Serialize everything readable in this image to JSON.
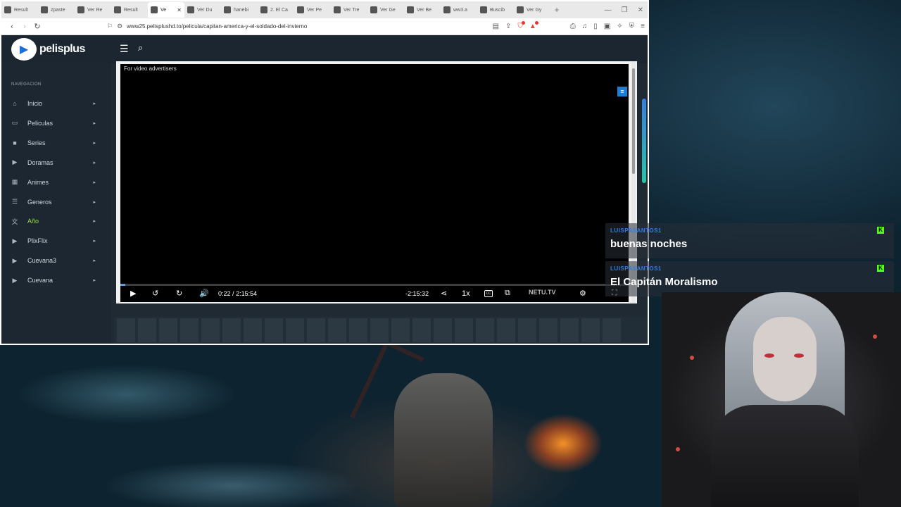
{
  "browser": {
    "tabs": [
      {
        "label": "Result",
        "icon": "google-icon",
        "active": false
      },
      {
        "label": "zpaste",
        "icon": "sync-icon",
        "active": false
      },
      {
        "label": "Ver Re",
        "icon": "c-icon",
        "active": false
      },
      {
        "label": "Result",
        "icon": "c-icon",
        "active": false
      },
      {
        "label": "Ve",
        "icon": "p-icon",
        "active": true
      },
      {
        "label": "Ver Du",
        "icon": "c-icon",
        "active": false
      },
      {
        "label": "hanebi",
        "icon": "m-icon",
        "active": false
      },
      {
        "label": "2. El Ca",
        "icon": "doc-icon",
        "active": false
      },
      {
        "label": "Ver Pe",
        "icon": "circle-icon",
        "active": false
      },
      {
        "label": "Ver Tre",
        "icon": "arrow-icon",
        "active": false
      },
      {
        "label": "Ver Ge",
        "icon": "arrow-icon",
        "active": false
      },
      {
        "label": "Ver Be",
        "icon": "circle-icon",
        "active": false
      },
      {
        "label": "ww3.a",
        "icon": "grid-icon",
        "active": false
      },
      {
        "label": "Buscib",
        "icon": "c-icon",
        "active": false
      },
      {
        "label": "Ver Gy",
        "icon": "p-icon",
        "active": false
      }
    ],
    "new_tab": "+",
    "url": "www25.pelisplushd.to/pelicula/capitan-america-y-el-soldado-del-invierno"
  },
  "site": {
    "logo_text": "pelisplus",
    "nav_heading": "NAVEGACION",
    "nav": [
      {
        "label": "Inicio",
        "icon": "home-icon",
        "glyph": "⌂",
        "active": false
      },
      {
        "label": "Peliculas",
        "icon": "monitor-icon",
        "glyph": "▭",
        "active": false
      },
      {
        "label": "Series",
        "icon": "camera-icon",
        "glyph": "■",
        "active": false
      },
      {
        "label": "Doramas",
        "icon": "play-icon",
        "glyph": "▶",
        "active": false
      },
      {
        "label": "Animes",
        "icon": "tv-icon",
        "glyph": "▦",
        "active": false
      },
      {
        "label": "Generos",
        "icon": "list-icon",
        "glyph": "☰",
        "active": false
      },
      {
        "label": "Año",
        "icon": "translate-icon",
        "glyph": "文",
        "active": true
      },
      {
        "label": "PlixFlix",
        "icon": "play-icon",
        "glyph": "▶",
        "active": false
      },
      {
        "label": "Cuevana3",
        "icon": "play-icon",
        "glyph": "▶",
        "active": false
      },
      {
        "label": "Cuevana",
        "icon": "play-icon",
        "glyph": "▶",
        "active": false
      }
    ]
  },
  "player": {
    "ad_caption": "For video advertisers",
    "current_time": "0:22",
    "separator": "/",
    "duration": "2:15:54",
    "remaining": "-2:15:32",
    "speed": "1x",
    "cc_label": "CC",
    "brand": "NETU.TV",
    "progress_fraction": 0.0027
  },
  "chat": [
    {
      "user": "LUISPASANTOS1",
      "text": "buenas noches"
    },
    {
      "user": "LUISPASANTOS1",
      "text": "El Capitán Moralismo"
    }
  ],
  "colors": {
    "accent_green": "#9be13f",
    "chat_user": "#2f7ee6",
    "kick_green": "#53fc18"
  }
}
